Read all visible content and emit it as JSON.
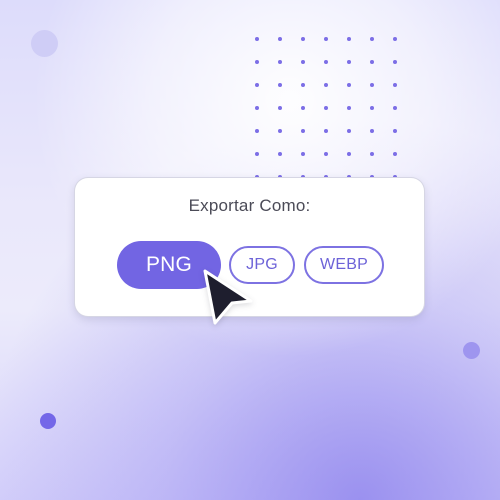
{
  "export": {
    "title": "Exportar Como:",
    "selected_format": "PNG",
    "formats": [
      {
        "label": "PNG",
        "selected": true
      },
      {
        "label": "JPG",
        "selected": false
      },
      {
        "label": "WEBP",
        "selected": false
      }
    ]
  },
  "colors": {
    "accent": "#7265E3",
    "outline": "#7D72E2",
    "card": "#FFFFFF",
    "cursor": "#1E1E2E"
  },
  "icons": {
    "cursor": "mouse-pointer-icon"
  }
}
